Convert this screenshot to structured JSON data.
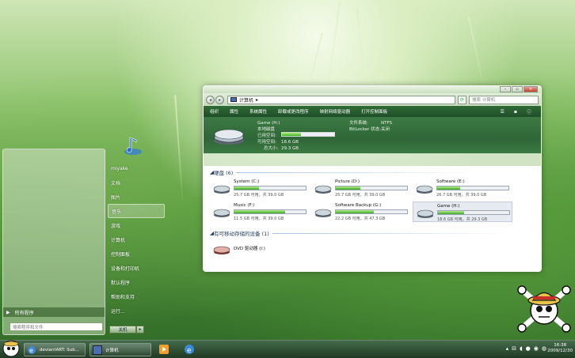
{
  "start_menu": {
    "user_name": "miyake",
    "items": [
      "文档",
      "图片",
      "音乐",
      "游戏",
      "计算机",
      "控制面板",
      "设备和打印机",
      "默认程序",
      "帮助和支持",
      "运行..."
    ],
    "all_programs": "所有程序",
    "search_placeholder": "搜索程序和文件",
    "shutdown_label": "关机",
    "shutdown_arrow": "▸"
  },
  "explorer": {
    "address": "计算机",
    "address_arrow": "▸",
    "search_placeholder": "搜索 计算机",
    "toolbar": [
      "组织",
      "属性",
      "系统属性",
      "卸载或更改程序",
      "映射网络驱动器",
      "打开控制面板"
    ],
    "detail": {
      "name": "Game (H:)",
      "type": "本地磁盘",
      "used_label": "已用空间:",
      "free_label": "可用空间:",
      "free_value": "18.6 GB",
      "total_label": "总大小:",
      "total_value": "29.3 GB",
      "used_fraction": 0.37,
      "fs_label": "文件系统:",
      "fs_value": "NTFS",
      "bitlocker_label": "BitLocker 状态:",
      "bitlocker_value": "关闭"
    },
    "hard_disks_title": "硬盘 (6)",
    "drives": [
      {
        "name": "System (C:)",
        "info": "25.7 GB 可用，共 39.0 GB",
        "used": 0.34
      },
      {
        "name": "Picture (D:)",
        "info": "25.7 GB 可用，共 39.0 GB",
        "used": 0.34
      },
      {
        "name": "Software (E:)",
        "info": "26.7 GB 可用，共 39.0 GB",
        "used": 0.32
      },
      {
        "name": "Music (F:)",
        "info": "11.5 GB 可用，共 39.0 GB",
        "used": 0.71
      },
      {
        "name": "Software Backup (G:)",
        "info": "22.2 GB 可用，共 47.3 GB",
        "used": 0.53
      },
      {
        "name": "Game (H:)",
        "info": "18.6 GB 可用，共 29.3 GB",
        "used": 0.37
      }
    ],
    "removable_title": "有可移动存储的设备 (1)",
    "dvd": "DVD 驱动器 (I:)"
  },
  "taskbar": {
    "tasks": [
      "deviantART: Sub...",
      "计算机"
    ],
    "time": "16:38",
    "date": "2009/12/30"
  },
  "colors": {
    "toolbar": "#2e6b36",
    "progress": "#3aa628",
    "taskbar": "#1e3722"
  }
}
